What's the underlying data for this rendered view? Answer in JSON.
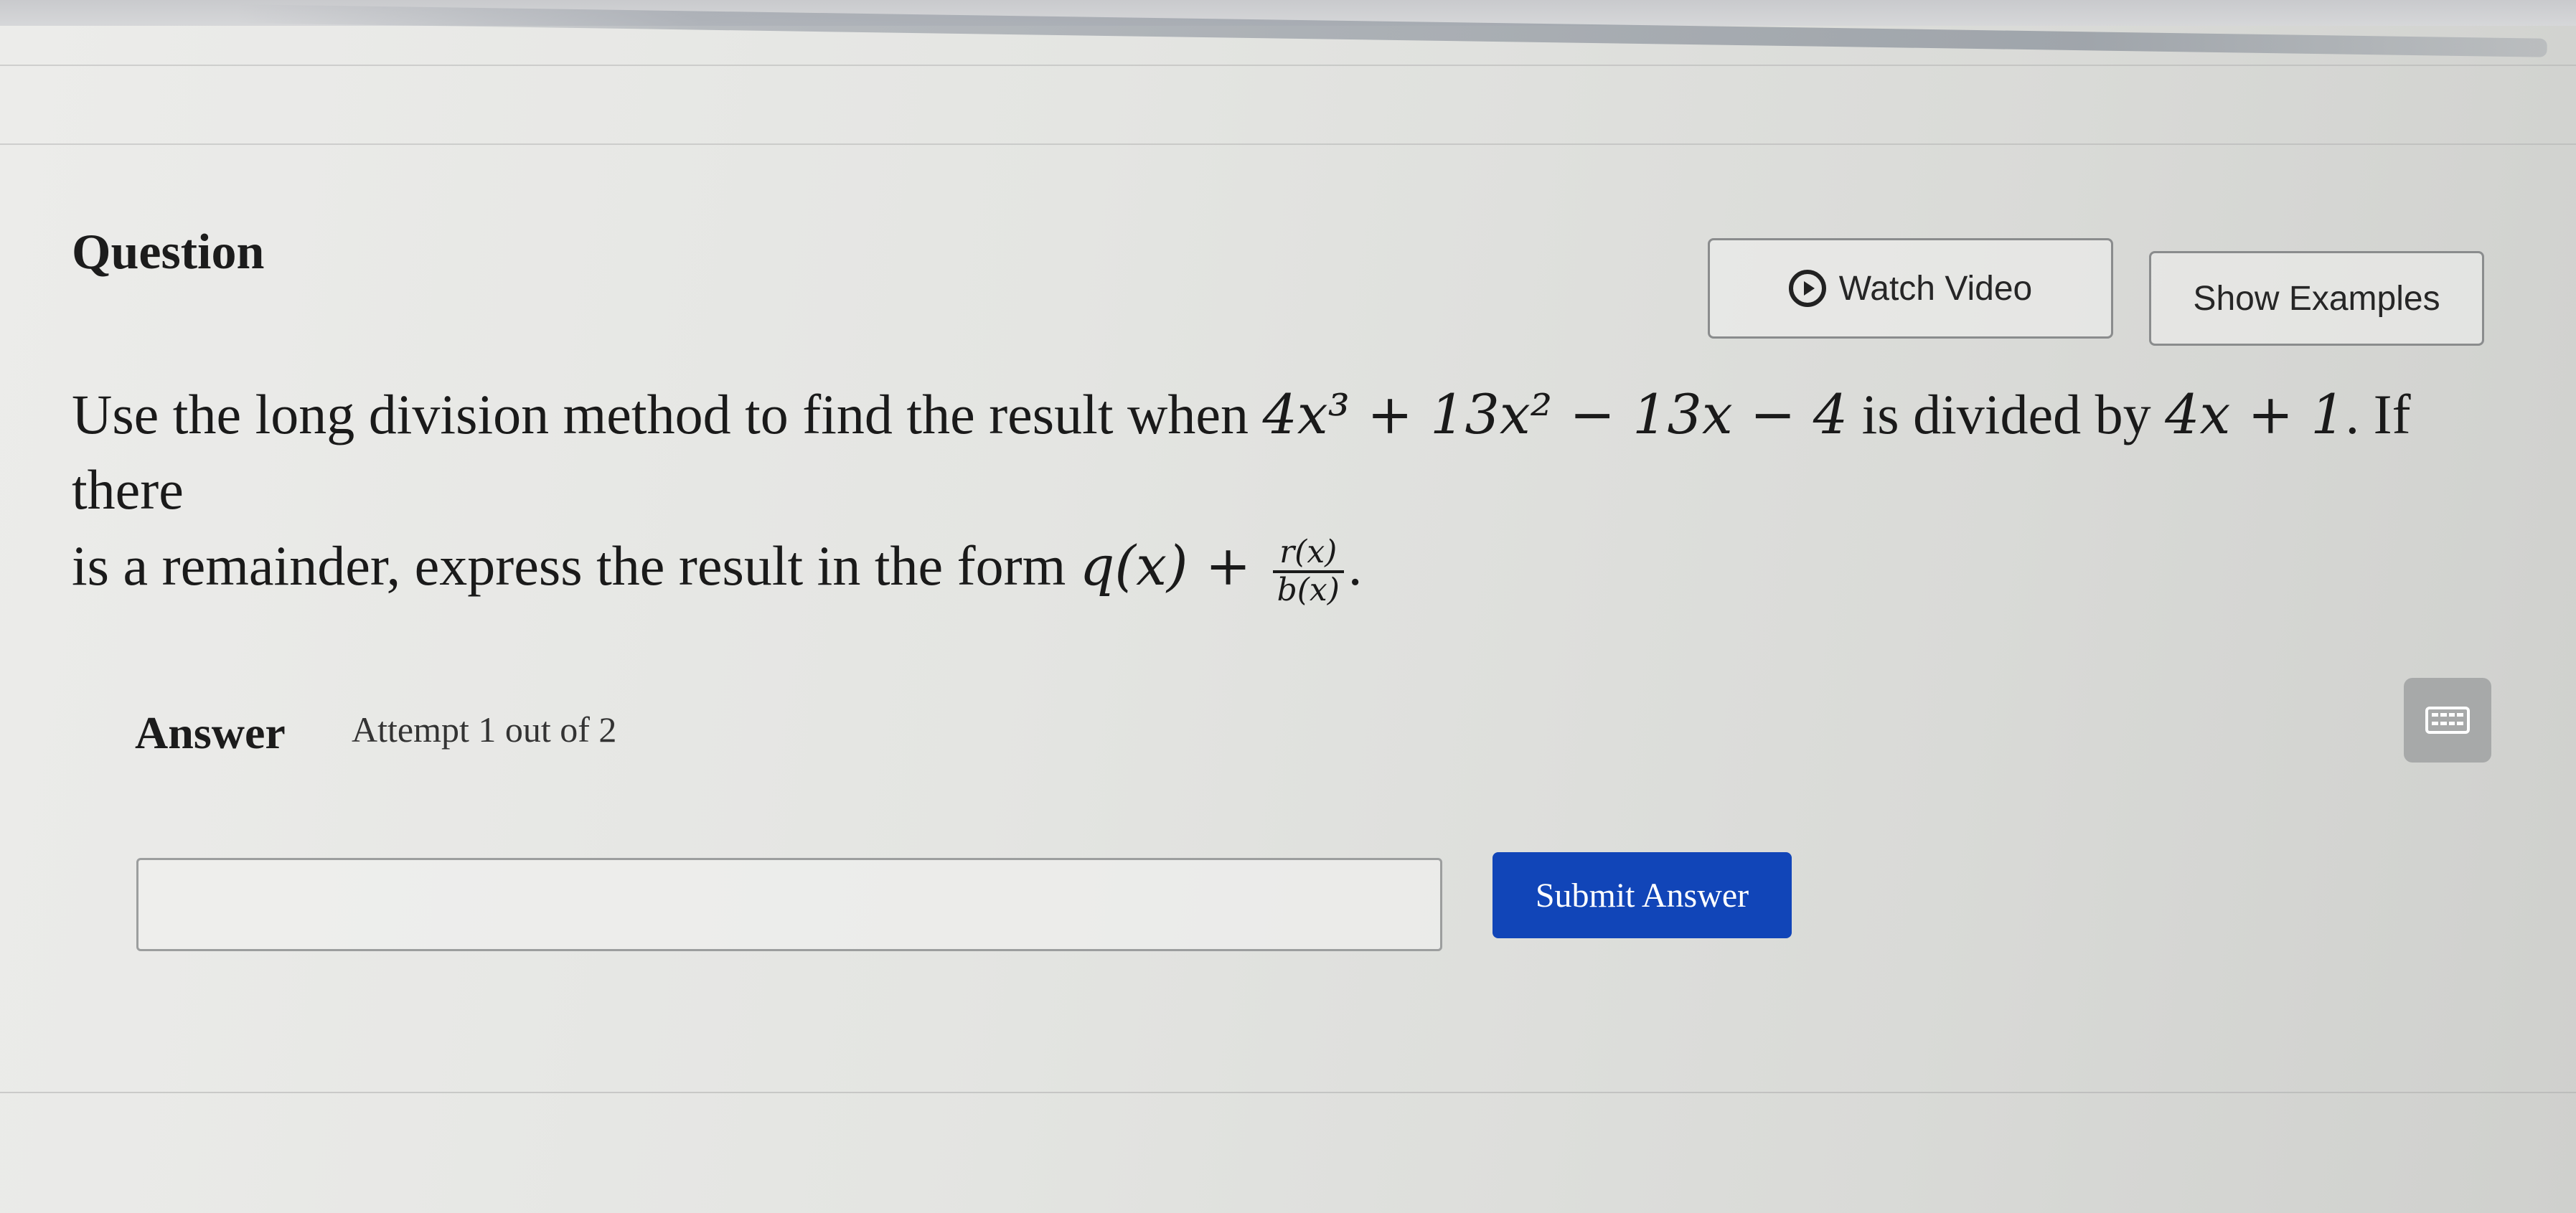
{
  "header": {
    "question_label": "Question"
  },
  "buttons": {
    "watch_video": "Watch Video",
    "show_examples": "Show Examples",
    "submit_answer": "Submit Answer"
  },
  "problem": {
    "text_1": "Use the long division method to find the result when ",
    "dividend": "4x³ + 13x² − 13x − 4",
    "text_2": " is divided by ",
    "divisor": "4x + 1",
    "text_3": ". If there",
    "text_4": "is a remainder, express the result in the form ",
    "form_prefix": "q(x) + ",
    "frac_num": "r(x)",
    "frac_den": "b(x)",
    "text_5": "."
  },
  "answer": {
    "label": "Answer",
    "attempt": "Attempt 1 out of 2",
    "input_value": ""
  },
  "icons": {
    "play": "play-circle-icon",
    "keyboard": "keyboard-icon"
  }
}
